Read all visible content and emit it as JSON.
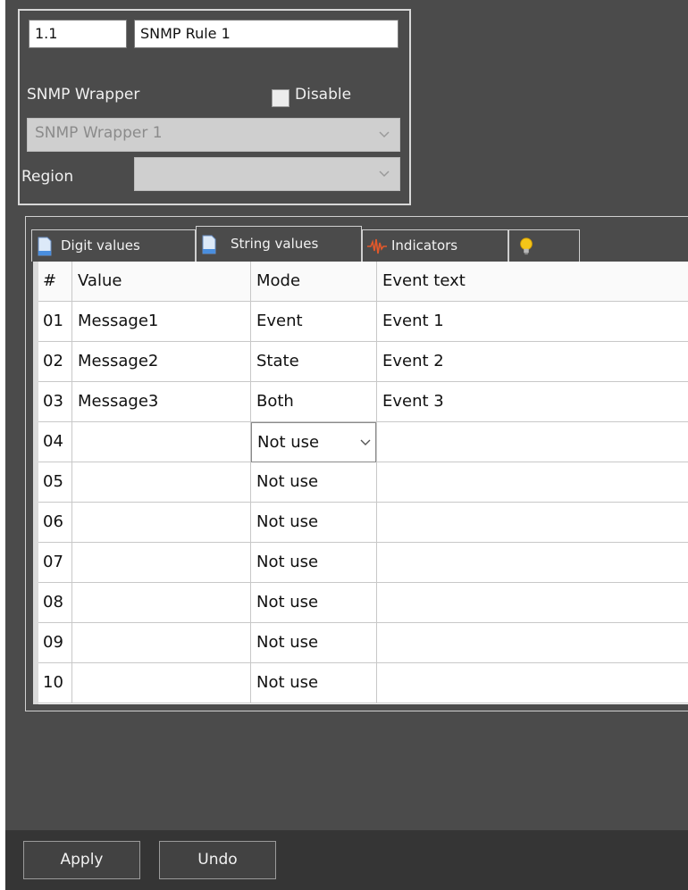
{
  "rule": {
    "number": "1.1",
    "name": "SNMP Rule 1",
    "wrapper_label": "SNMP Wrapper",
    "disable_label": "Disable",
    "disable_checked": false,
    "wrapper_value": "SNMP Wrapper 1",
    "region_label": "Region",
    "region_value": ""
  },
  "tabs": [
    {
      "label": "Digit values",
      "icon": "document-icon",
      "active": false
    },
    {
      "label": "String values",
      "icon": "document-icon",
      "active": true
    },
    {
      "label": "Indicators",
      "icon": "waveform-icon",
      "active": false
    },
    {
      "label": "",
      "icon": "lightbulb-icon",
      "active": false
    }
  ],
  "grid": {
    "headers": [
      "#",
      "Value",
      "Mode",
      "Event text"
    ],
    "rows": [
      {
        "n": "01",
        "value": "Message1",
        "mode": "Event",
        "text": "Event 1"
      },
      {
        "n": "02",
        "value": "Message2",
        "mode": "State",
        "text": "Event 2"
      },
      {
        "n": "03",
        "value": "Message3",
        "mode": "Both",
        "text": "Event 3"
      },
      {
        "n": "04",
        "value": "",
        "mode": "Not use",
        "text": "",
        "editing": true
      },
      {
        "n": "05",
        "value": "",
        "mode": "Not use",
        "text": ""
      },
      {
        "n": "06",
        "value": "",
        "mode": "Not use",
        "text": ""
      },
      {
        "n": "07",
        "value": "",
        "mode": "Not use",
        "text": ""
      },
      {
        "n": "08",
        "value": "",
        "mode": "Not use",
        "text": ""
      },
      {
        "n": "09",
        "value": "",
        "mode": "Not use",
        "text": ""
      },
      {
        "n": "10",
        "value": "",
        "mode": "Not use",
        "text": ""
      }
    ]
  },
  "footer": {
    "apply_label": "Apply",
    "undo_label": "Undo"
  },
  "colors": {
    "panel": "#4b4b4b",
    "footer": "#353535",
    "border": "#d8d8d8"
  }
}
